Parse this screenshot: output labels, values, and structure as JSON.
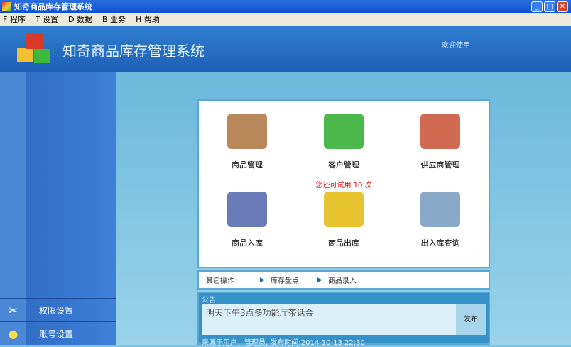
{
  "window": {
    "title": "知奇商品库存管理系统"
  },
  "menu": [
    {
      "label": "F 程序"
    },
    {
      "label": "T 设置"
    },
    {
      "label": "D 数据"
    },
    {
      "label": "B 业务"
    },
    {
      "label": "H 帮助"
    }
  ],
  "header": {
    "title": "知奇商品库存管理系统",
    "welcome": "欢迎使用"
  },
  "sidebar": [
    {
      "label": "权限设置",
      "icon": "tools-icon"
    },
    {
      "label": "账号设置",
      "icon": "bulb-icon"
    }
  ],
  "modules": [
    {
      "label": "商品管理",
      "color": "#b8875a"
    },
    {
      "label": "客户管理",
      "color": "#4cb84c"
    },
    {
      "label": "供应商管理",
      "color": "#d06a50"
    },
    {
      "label": "商品入库",
      "color": "#6a7ab8"
    },
    {
      "label": "商品出库",
      "color": "#e8c430"
    },
    {
      "label": "出入库查询",
      "color": "#8aa8c8"
    }
  ],
  "trial": "您还可试用 10 次",
  "ops": {
    "label": "其它操作：",
    "links": [
      "库存盘点",
      "商品录入"
    ]
  },
  "notice": {
    "label": "公告",
    "text": "明天下午3点多功能厅茶话会",
    "publish": "发布",
    "meta": "来源于用户：管理员,   发布时间:2014-10-13 22:30"
  }
}
